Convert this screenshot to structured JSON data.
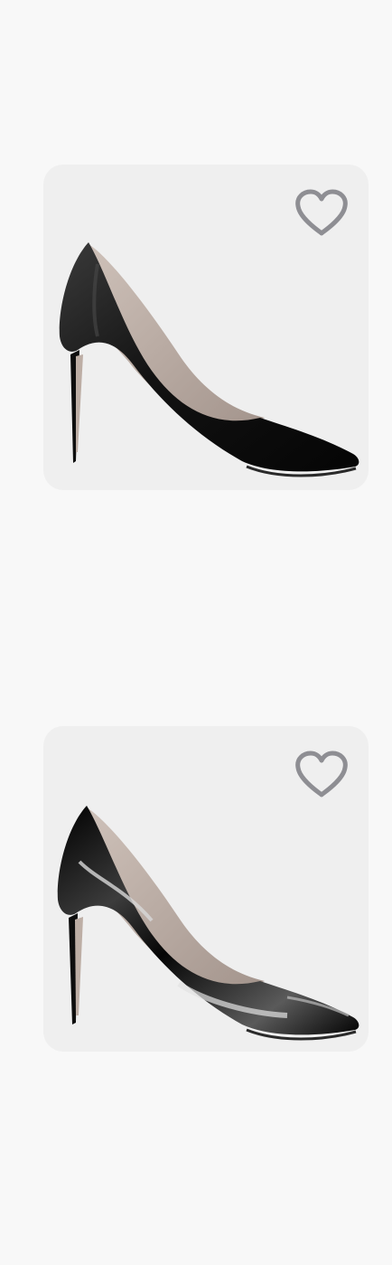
{
  "products": [
    {
      "image_icon": "black-leather-stiletto-pump",
      "finish": "leather",
      "favorite_icon": "heart-outline-icon",
      "favorited": false
    },
    {
      "image_icon": "black-patent-stiletto-pump",
      "finish": "patent",
      "favorite_icon": "heart-outline-icon",
      "favorited": false
    }
  ],
  "colors": {
    "page_background": "#f8f8f8",
    "card_background": "#efefef",
    "heart_stroke": "#8e8e93",
    "shoe_black": "#151515",
    "shoe_lining": "#b9aaa2"
  }
}
